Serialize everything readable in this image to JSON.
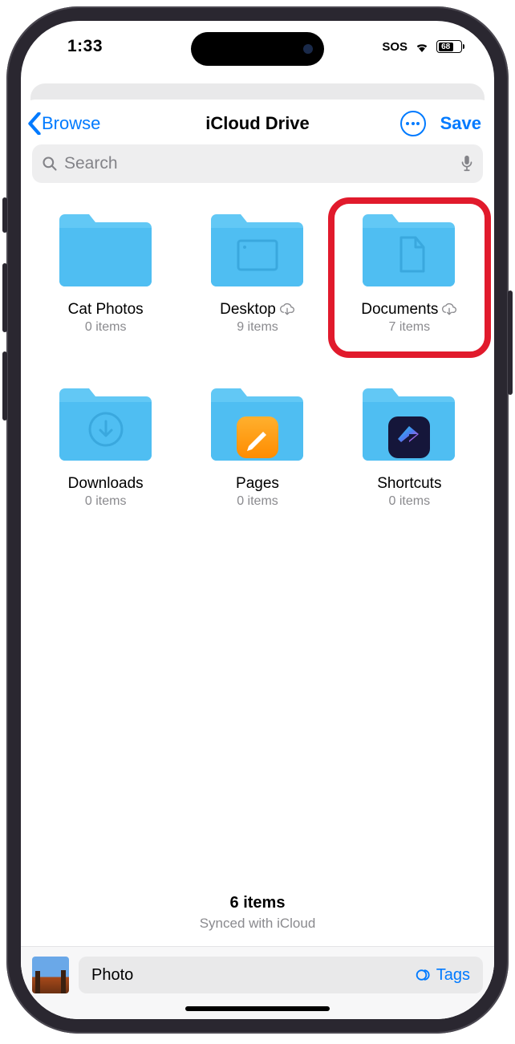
{
  "status": {
    "time": "1:33",
    "sos": "SOS",
    "battery": "68"
  },
  "nav": {
    "back": "Browse",
    "title": "iCloud Drive",
    "save": "Save"
  },
  "search": {
    "placeholder": "Search"
  },
  "folders": [
    {
      "name": "Cat Photos",
      "sub": "0 items",
      "icon": "plain",
      "cloud": false,
      "highlight": false
    },
    {
      "name": "Desktop",
      "sub": "9 items",
      "icon": "desktop",
      "cloud": true,
      "highlight": false
    },
    {
      "name": "Documents",
      "sub": "7 items",
      "icon": "document",
      "cloud": true,
      "highlight": true
    },
    {
      "name": "Downloads",
      "sub": "0 items",
      "icon": "download",
      "cloud": false,
      "highlight": false
    },
    {
      "name": "Pages",
      "sub": "0 items",
      "icon": "pages",
      "cloud": false,
      "highlight": false
    },
    {
      "name": "Shortcuts",
      "sub": "0 items",
      "icon": "shortcuts",
      "cloud": false,
      "highlight": false
    }
  ],
  "summary": {
    "count": "6 items",
    "sub": "Synced with iCloud"
  },
  "bottom": {
    "filename": "Photo",
    "tags": "Tags"
  }
}
